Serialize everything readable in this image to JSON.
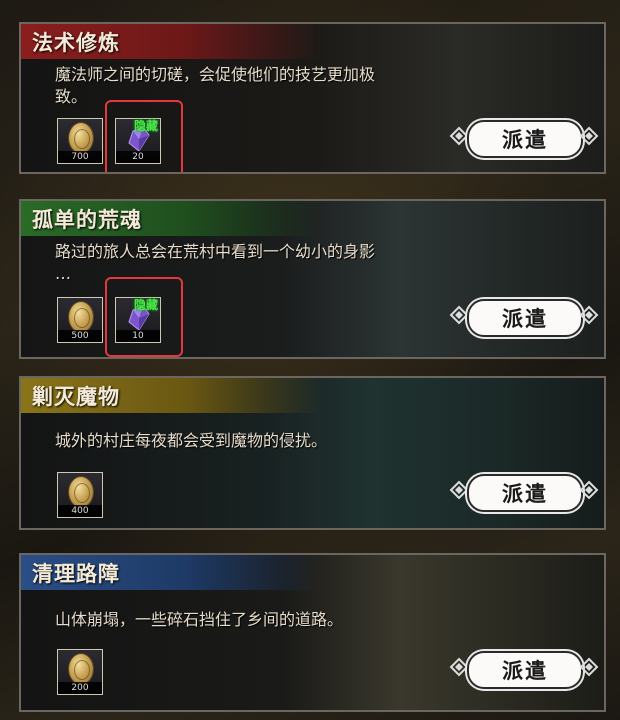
{
  "missions": [
    {
      "title": "法术修炼",
      "desc_lines": [
        "魔法师之间的切磋，会促使他们的技艺更加极",
        "致。"
      ],
      "rewards": [
        {
          "type": "gold-coin",
          "count": "700"
        },
        {
          "type": "purple-crystal",
          "count": "20",
          "tag": "隐藏"
        }
      ],
      "button": "派遣",
      "title_color": "#7a1b1b"
    },
    {
      "title": "孤单的荒魂",
      "desc_lines": [
        "路过的旅人总会在荒村中看到一个幼小的身影",
        "…"
      ],
      "rewards": [
        {
          "type": "gold-coin",
          "count": "500"
        },
        {
          "type": "purple-crystal",
          "count": "10",
          "tag": "隐藏"
        }
      ],
      "button": "派遣",
      "title_color": "#1f5a1f"
    },
    {
      "title": "剿灭魔物",
      "desc_lines": [
        "城外的村庄每夜都会受到魔物的侵扰。"
      ],
      "rewards": [
        {
          "type": "gold-coin",
          "count": "400"
        }
      ],
      "button": "派遣",
      "title_color": "#7a6414"
    },
    {
      "title": "清理路障",
      "desc_lines": [
        "山体崩塌，一些碎石挡住了乡间的道路。"
      ],
      "rewards": [
        {
          "type": "gold-coin",
          "count": "200"
        }
      ],
      "button": "派遣",
      "title_color": "#1d3a6a"
    }
  ]
}
